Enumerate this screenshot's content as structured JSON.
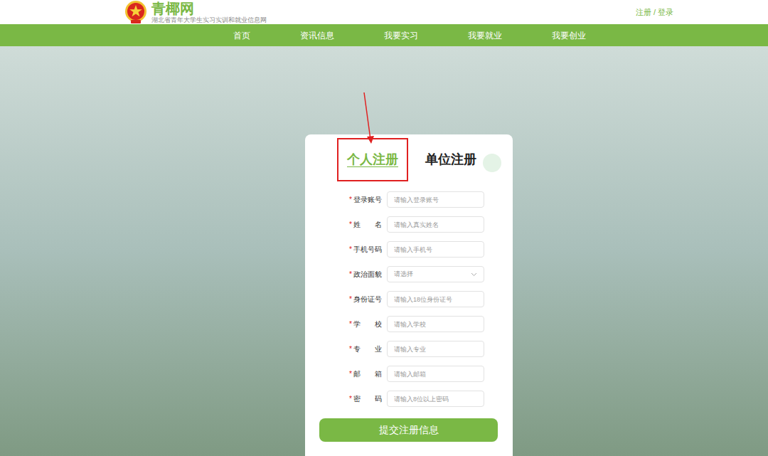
{
  "header": {
    "site_name": "青椰网",
    "subtitle": "湖北省青年大学生实习实训和就业信息网",
    "auth_links": "注册 / 登录"
  },
  "nav": [
    {
      "label": "首页"
    },
    {
      "label": "资讯信息"
    },
    {
      "label": "我要实习"
    },
    {
      "label": "我要就业"
    },
    {
      "label": "我要创业"
    }
  ],
  "tabs": [
    {
      "label": "个人注册",
      "selected": true,
      "annotated": true
    },
    {
      "label": "单位注册",
      "selected": false,
      "annotated": false
    }
  ],
  "fields": [
    {
      "label": "登录账号",
      "required": true,
      "kind": "input",
      "placeholder": "请输入登录账号"
    },
    {
      "label": "姓　　名",
      "required": true,
      "kind": "input",
      "placeholder": "请输入真实姓名"
    },
    {
      "label": "手机号码",
      "required": true,
      "kind": "input",
      "placeholder": "请输入手机号"
    },
    {
      "label": "政治面貌",
      "required": true,
      "kind": "select",
      "placeholder": "请选择"
    },
    {
      "label": "身份证号",
      "required": true,
      "kind": "input",
      "placeholder": "请输入18位身份证号"
    },
    {
      "label": "学　　校",
      "required": true,
      "kind": "input",
      "placeholder": "请输入学校"
    },
    {
      "label": "专　　业",
      "required": true,
      "kind": "input",
      "placeholder": "请输入专业"
    },
    {
      "label": "邮　　箱",
      "required": true,
      "kind": "input",
      "placeholder": "请输入邮箱"
    },
    {
      "label": "密　　码",
      "required": true,
      "kind": "input",
      "placeholder": "请输入8位以上密码"
    }
  ],
  "required_mark": "*",
  "submit_button": "提交注册信息"
}
